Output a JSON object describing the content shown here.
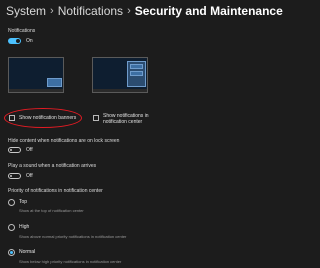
{
  "breadcrumb": {
    "items": [
      "System",
      "Notifications"
    ],
    "current": "Security and Maintenance",
    "separator": "›"
  },
  "notifications": {
    "title": "Notifications",
    "toggle_state": "On"
  },
  "banner_options": {
    "show_banners_label": "Show notification banners",
    "show_in_center_label": "Show notifications in notification center"
  },
  "lock_screen": {
    "title": "Hide content when notifications are on lock screen",
    "toggle_state": "Off"
  },
  "sound": {
    "title": "Play a sound when a notification arrives",
    "toggle_state": "Off"
  },
  "priority": {
    "title": "Priority of notifications in notification center",
    "options": [
      {
        "label": "Top",
        "description": "Show at the top of notification center"
      },
      {
        "label": "High",
        "description": "Show above normal priority notifications in notification center"
      },
      {
        "label": "Normal",
        "description": "Show below high priority notifications in notification center"
      }
    ],
    "selected": "Normal"
  },
  "colors": {
    "accent": "#4cc2ff",
    "annotation_red": "#e31b23",
    "background": "#1c1c1c"
  }
}
